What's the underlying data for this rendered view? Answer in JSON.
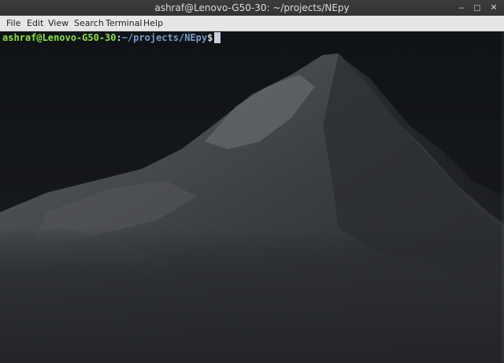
{
  "window": {
    "title": "ashraf@Lenovo-G50-30: ~/projects/NEpy",
    "controls": {
      "minimize": "‒",
      "maximize": "◻",
      "close": "✕"
    }
  },
  "menu": {
    "items": [
      "File",
      "Edit",
      "View",
      "Search",
      "Terminal",
      "Help"
    ]
  },
  "terminal": {
    "prompt_user": "ashraf@Lenovo-G50-30",
    "prompt_colon": ":",
    "prompt_path": "~/projects/NEpy",
    "prompt_symbol": "$",
    "colors": {
      "user": "#8ae234",
      "path": "#729fcf",
      "background": "#111418"
    }
  }
}
